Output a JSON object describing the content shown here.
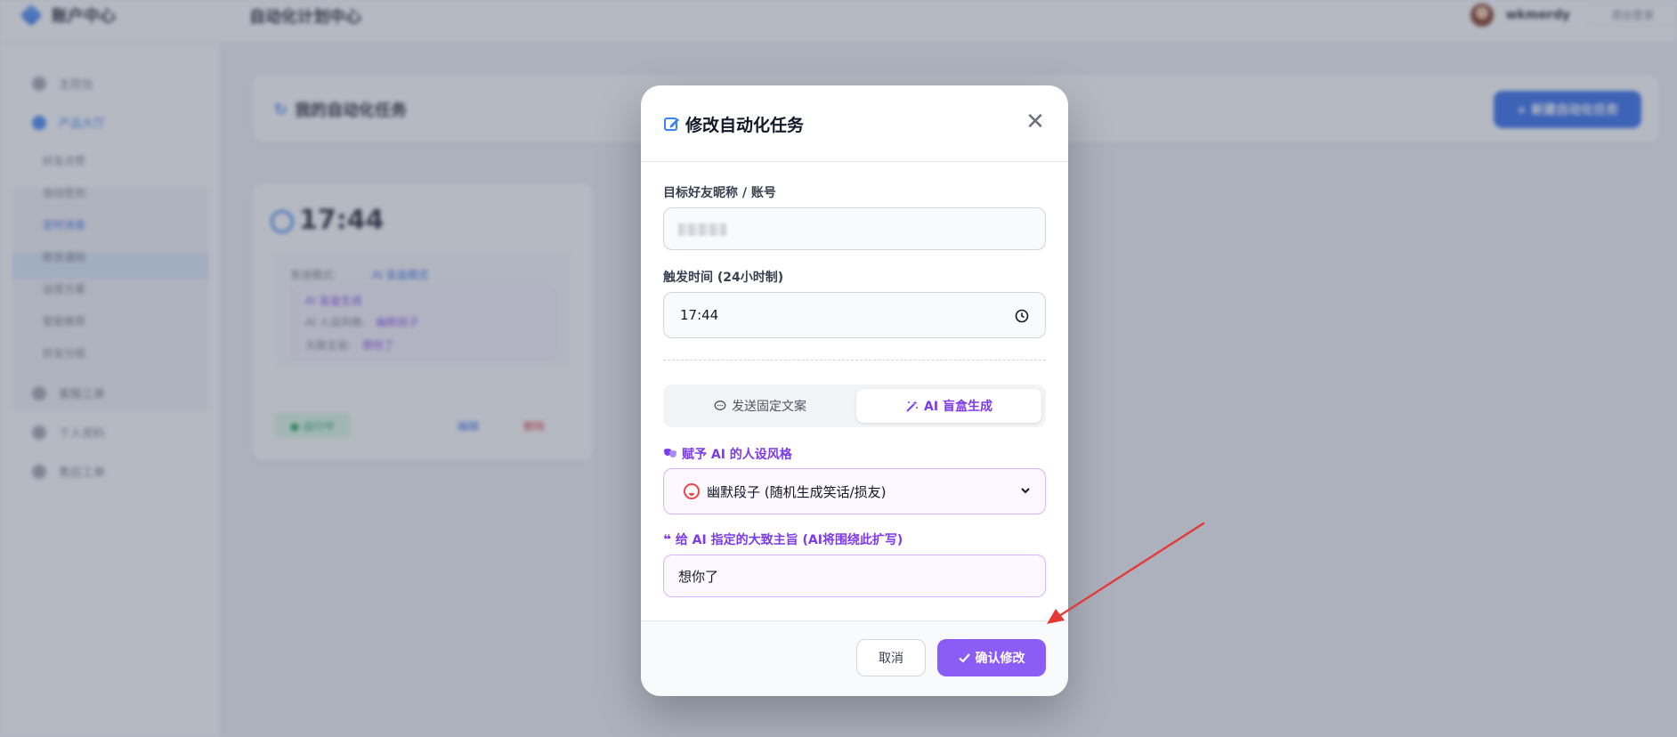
{
  "app": {
    "brand": "账户中心",
    "topbar_title": "自动化计划中心",
    "user_name": "wkmerdy",
    "logout": "退出登录"
  },
  "sidebar": {
    "items": [
      "主控台",
      "产品大厅",
      "客服工单",
      "个人资料",
      "售后工单"
    ],
    "sub_items": [
      "好友点赞",
      "自动签到",
      "定时消息",
      "群发通知",
      "运营方案",
      "智能推荐",
      "好友分组"
    ]
  },
  "main": {
    "header_title": "我的自动化任务",
    "new_task_button": "+ 新建自动化任务"
  },
  "task_card": {
    "time": "17:44",
    "mode_label": "发送模式:",
    "mode_value": "AI 盲盒模式",
    "ai_title": "AI 盲盒生成",
    "persona_label": "AI 人设风格:",
    "persona_value": "幽默段子",
    "topic_label": "大致主旨:",
    "topic_value": "想你了",
    "status": "● 运行中",
    "edit": "编辑",
    "delete": "删除"
  },
  "modal": {
    "title": "修改自动化任务",
    "target_label": "目标好友昵称 / 账号",
    "time_label": "触发时间 (24小时制)",
    "time_value": "17:44",
    "mode_fixed": "发送固定文案",
    "mode_ai": "AI 盲盒生成",
    "persona_label": "赋予 AI 的人设风格",
    "persona_value": "幽默段子 (随机生成笑话/损友)",
    "topic_label": "给 AI 指定的大致主旨 (AI将围绕此扩写)",
    "topic_value": "想你了",
    "cancel": "取消",
    "confirm": "确认修改"
  },
  "colors": {
    "accent_purple": "#8b5cf6",
    "accent_blue": "#2563eb",
    "annotation_red": "#e53935"
  }
}
